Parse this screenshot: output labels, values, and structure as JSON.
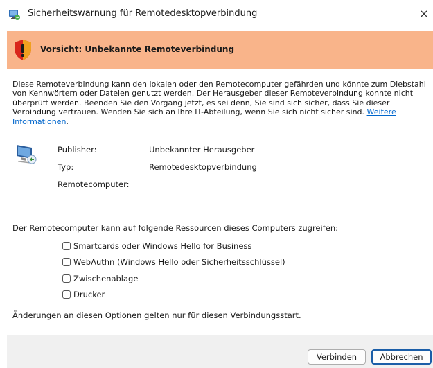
{
  "window": {
    "title": "Sicherheitswarnung für Remotedesktopverbindung",
    "close_glyph": "×"
  },
  "banner": {
    "text": "Vorsicht: Unbekannte Remoteverbindung",
    "color": "#f9b48a",
    "icon": "shield-warning-icon"
  },
  "description": {
    "text": "Diese Remoteverbindung kann den lokalen oder den Remotecomputer gefährden und könnte zum Diebstahl von Kennwörtern oder Dateien genutzt werden. Der Herausgeber dieser Remoteverbindung konnte nicht überprüft werden. Beenden Sie den Vorgang jetzt, es sei denn, Sie sind sich sicher, dass Sie dieser Verbindung vertrauen. Wenden Sie sich an Ihre IT-Abteilung, wenn Sie sich nicht sicher sind.",
    "link": "Weitere Informationen",
    "link_suffix": "."
  },
  "details": {
    "icon": "remote-computer-icon",
    "publisher_label": "Publisher:",
    "publisher_value": "Unbekannter Herausgeber",
    "type_label": "Typ:",
    "type_value": "Remotedesktopverbindung",
    "remote_label": "Remotecomputer:",
    "remote_value": ""
  },
  "resources": {
    "heading": "Der Remotecomputer kann auf folgende Ressourcen dieses Computers zugreifen:",
    "options": [
      {
        "label": "Smartcards oder Windows Hello for Business",
        "checked": false
      },
      {
        "label": "WebAuthn (Windows Hello oder Sicherheitsschlüssel)",
        "checked": false
      },
      {
        "label": "Zwischenablage",
        "checked": false
      },
      {
        "label": "Drucker",
        "checked": false
      }
    ],
    "note": "Änderungen an diesen Optionen gelten nur für diesen Verbindungsstart."
  },
  "buttons": {
    "connect": "Verbinden",
    "cancel": "Abbrechen",
    "accent": "#1b5ea8"
  }
}
